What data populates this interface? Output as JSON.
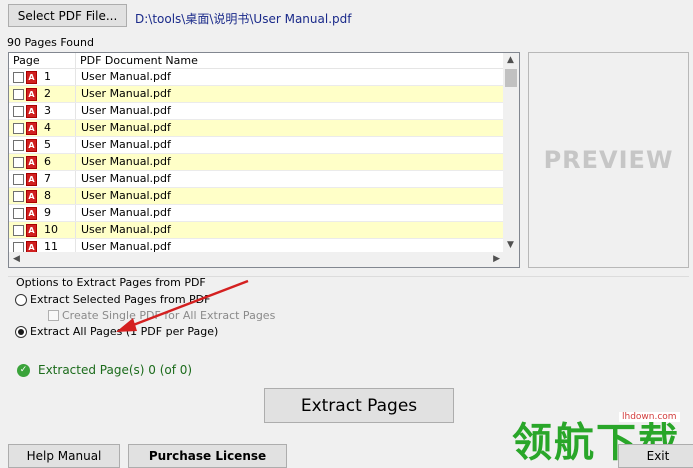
{
  "toolbar": {
    "select_label": "Select PDF File...",
    "file_path": "D:\\tools\\桌面\\说明书\\User Manual.pdf"
  },
  "list": {
    "count_label": "90 Pages Found",
    "headers": {
      "page": "Page",
      "name": "PDF Document Name"
    },
    "rows": [
      {
        "page": "1",
        "name": "User Manual.pdf"
      },
      {
        "page": "2",
        "name": "User Manual.pdf"
      },
      {
        "page": "3",
        "name": "User Manual.pdf"
      },
      {
        "page": "4",
        "name": "User Manual.pdf"
      },
      {
        "page": "5",
        "name": "User Manual.pdf"
      },
      {
        "page": "6",
        "name": "User Manual.pdf"
      },
      {
        "page": "7",
        "name": "User Manual.pdf"
      },
      {
        "page": "8",
        "name": "User Manual.pdf"
      },
      {
        "page": "9",
        "name": "User Manual.pdf"
      },
      {
        "page": "10",
        "name": "User Manual.pdf"
      },
      {
        "page": "11",
        "name": "User Manual.pdf"
      }
    ]
  },
  "preview": {
    "label": "PREVIEW"
  },
  "options": {
    "title": "Options to Extract Pages from PDF",
    "selected_label": "Extract Selected Pages from PDF",
    "single_label": "Create Single PDF for All Extract Pages",
    "all_label": "Extract All Pages (1 PDF per Page)",
    "selected_mode": "all"
  },
  "status": {
    "text": "Extracted Page(s) 0 (of 0)"
  },
  "actions": {
    "extract_label": "Extract Pages",
    "help_label": "Help Manual",
    "license_label": "Purchase License",
    "exit_label": "Exit"
  },
  "watermark": {
    "text": "领航下载",
    "url": "lhdown.com"
  },
  "colors": {
    "row_even": "#ffffc8",
    "status_green": "#1b6b1b",
    "arrow_red": "#d42020"
  }
}
